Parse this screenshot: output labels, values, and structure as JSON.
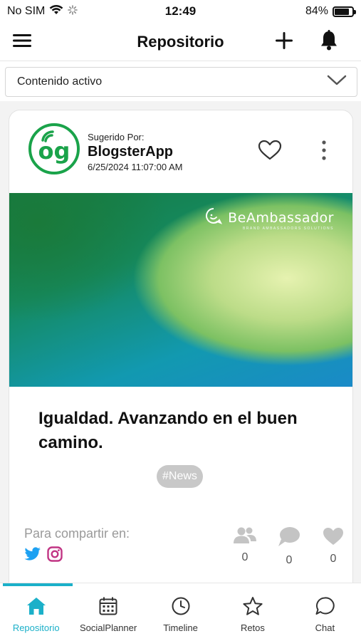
{
  "status_bar": {
    "carrier": "No SIM",
    "time": "12:49",
    "battery": "84%",
    "battery_level": 0.84
  },
  "header": {
    "title": "Repositorio",
    "icons": [
      "menu-icon",
      "plus-icon",
      "bell-icon"
    ]
  },
  "filter": {
    "selected": "Contenido activo"
  },
  "post": {
    "suggested_label": "Sugerido Por:",
    "author": "BlogsterApp",
    "avatar_text": "og",
    "date": "6/25/2024 11:07:00 AM",
    "image_brand": "BeAmbassador",
    "image_brand_sub": "BRAND AMBASSADORS SOLUTIONS",
    "title": "Igualdad. Avanzando en el buen camino.",
    "tag": "#News",
    "share_label": "Para compartir en:",
    "share_networks": [
      "twitter-icon",
      "instagram-icon"
    ],
    "stats": [
      {
        "icon": "users-icon",
        "count": "0"
      },
      {
        "icon": "comment-icon",
        "count": "0"
      },
      {
        "icon": "heart-icon",
        "count": "0"
      }
    ],
    "progress": 1.0
  },
  "colors": {
    "accent": "#1bb0c9",
    "avatar_green": "#1aa34a",
    "tag_bg": "#c8c8c8",
    "twitter": "#1da1f2",
    "instagram": "#c13584"
  },
  "tabs": [
    {
      "label": "Repositorio",
      "icon": "home-icon",
      "active": true
    },
    {
      "label": "SocialPlanner",
      "icon": "calendar-icon",
      "active": false
    },
    {
      "label": "Timeline",
      "icon": "clock-icon",
      "active": false
    },
    {
      "label": "Retos",
      "icon": "star-icon",
      "active": false
    },
    {
      "label": "Chat",
      "icon": "chat-icon",
      "active": false
    }
  ]
}
